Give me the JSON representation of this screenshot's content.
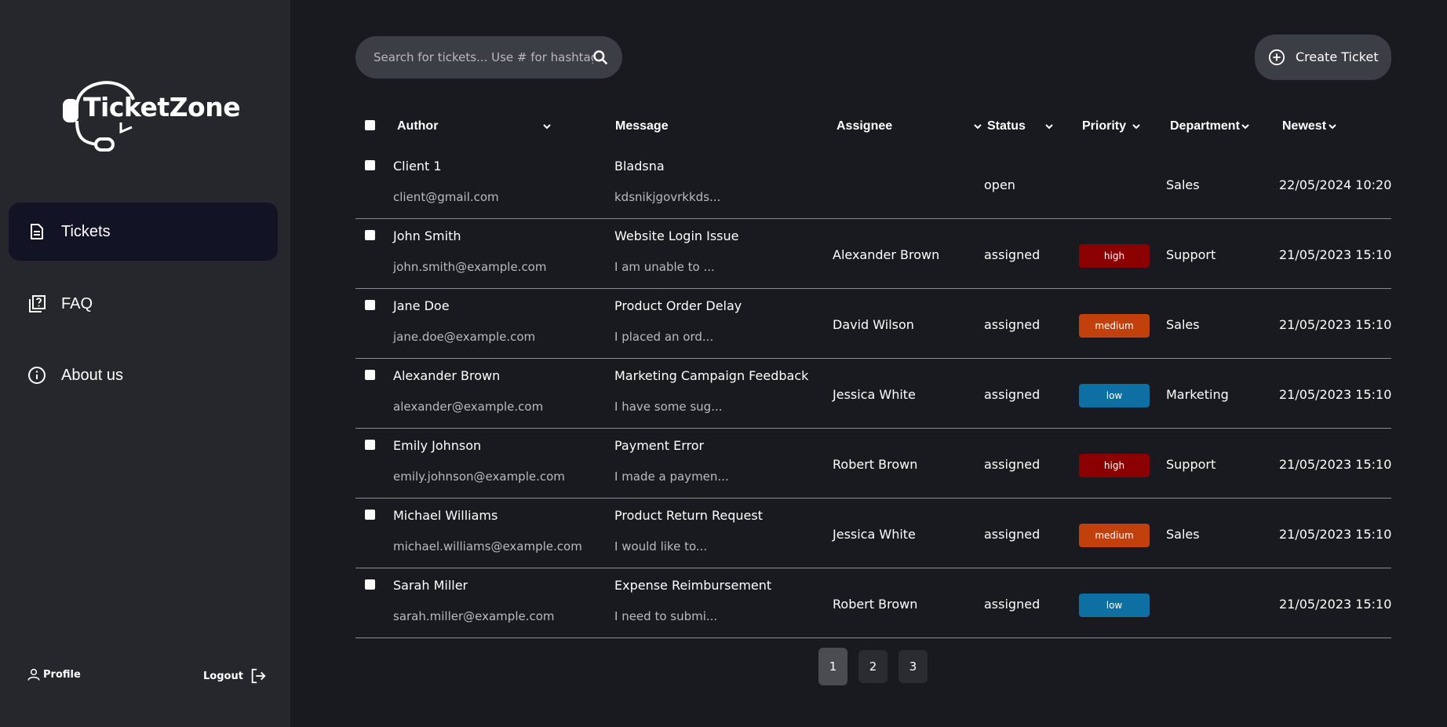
{
  "app": {
    "name": "TicketZone"
  },
  "sidebar": {
    "items": [
      {
        "label": "Tickets",
        "icon": "document-icon",
        "active": true
      },
      {
        "label": "FAQ",
        "icon": "faq-icon",
        "active": false
      },
      {
        "label": "About us",
        "icon": "info-icon",
        "active": false
      }
    ],
    "profile_label": "Profile",
    "logout_label": "Logout"
  },
  "search": {
    "placeholder": "Search for tickets... Use # for hashtags"
  },
  "create_button": {
    "label": "Create Ticket"
  },
  "table": {
    "columns": {
      "author": "Author",
      "message": "Message",
      "assignee": "Assignee",
      "status": "Status",
      "priority": "Priority",
      "department": "Department",
      "sort": "Newest"
    },
    "rows": [
      {
        "author": "Client 1",
        "email": "client@gmail.com",
        "subject": "Bladsna",
        "preview": "kdsnikjgovrkkds...",
        "assignee": "",
        "status": "open",
        "priority": "",
        "department": "Sales",
        "date": "22/05/2024 10:20"
      },
      {
        "author": "John Smith",
        "email": "john.smith@example.com",
        "subject": "Website Login Issue",
        "preview": "I am unable to ...",
        "assignee": "Alexander Brown",
        "status": "assigned",
        "priority": "high",
        "department": "Support",
        "date": "21/05/2023 15:10"
      },
      {
        "author": "Jane Doe",
        "email": "jane.doe@example.com",
        "subject": "Product Order Delay",
        "preview": "I placed an ord...",
        "assignee": "David Wilson",
        "status": "assigned",
        "priority": "medium",
        "department": "Sales",
        "date": "21/05/2023 15:10"
      },
      {
        "author": "Alexander Brown",
        "email": "alexander@example.com",
        "subject": "Marketing Campaign Feedback",
        "preview": "I have some sug...",
        "assignee": "Jessica White",
        "status": "assigned",
        "priority": "low",
        "department": "Marketing",
        "date": "21/05/2023 15:10"
      },
      {
        "author": "Emily Johnson",
        "email": "emily.johnson@example.com",
        "subject": "Payment Error",
        "preview": "I made a paymen...",
        "assignee": "Robert Brown",
        "status": "assigned",
        "priority": "high",
        "department": "Support",
        "date": "21/05/2023 15:10"
      },
      {
        "author": "Michael Williams",
        "email": "michael.williams@example.com",
        "subject": "Product Return Request",
        "preview": "I would like to...",
        "assignee": "Jessica White",
        "status": "assigned",
        "priority": "medium",
        "department": "Sales",
        "date": "21/05/2023 15:10"
      },
      {
        "author": "Sarah Miller",
        "email": "sarah.miller@example.com",
        "subject": "Expense Reimbursement",
        "preview": "I need to submi...",
        "assignee": "Robert Brown",
        "status": "assigned",
        "priority": "low",
        "department": "",
        "date": "21/05/2023 15:10"
      }
    ]
  },
  "priority_colors": {
    "high": "#8b0000",
    "medium": "#c2400c",
    "low": "#0e6fa3"
  },
  "pagination": {
    "pages": [
      "1",
      "2",
      "3"
    ],
    "current": "1"
  }
}
